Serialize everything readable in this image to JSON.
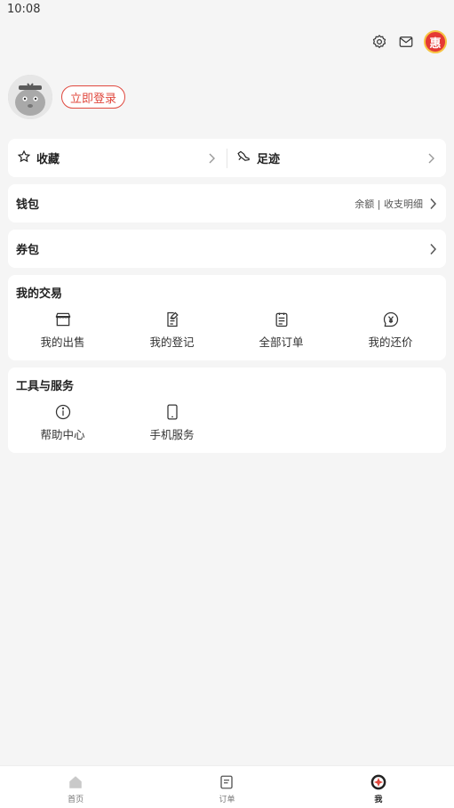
{
  "status_bar": {
    "time": "10:08"
  },
  "header": {
    "icons": [
      "settings-icon",
      "mail-icon",
      "promo-icon"
    ],
    "promo_glyph": "惠"
  },
  "profile": {
    "login_label": "立即登录"
  },
  "quick": {
    "favorites_label": "收藏",
    "footprints_label": "足迹"
  },
  "wallet": {
    "label": "钱包",
    "detail": "余额 | 收支明细"
  },
  "coupons": {
    "label": "券包"
  },
  "trade": {
    "title": "我的交易",
    "items": [
      {
        "label": "我的出售",
        "icon": "shop-icon"
      },
      {
        "label": "我的登记",
        "icon": "register-icon"
      },
      {
        "label": "全部订单",
        "icon": "orders-icon"
      },
      {
        "label": "我的还价",
        "icon": "yen-icon"
      }
    ]
  },
  "tools": {
    "title": "工具与服务",
    "items": [
      {
        "label": "帮助中心",
        "icon": "info-icon"
      },
      {
        "label": "手机服务",
        "icon": "phone-icon"
      }
    ]
  },
  "tabbar": {
    "items": [
      {
        "label": "首页",
        "icon": "home-icon",
        "active": false
      },
      {
        "label": "订单",
        "icon": "order-icon",
        "active": false
      },
      {
        "label": "我",
        "icon": "me-icon",
        "active": true
      }
    ]
  },
  "colors": {
    "accent": "#e0483e",
    "background": "#f5f5f5",
    "card": "#ffffff"
  }
}
